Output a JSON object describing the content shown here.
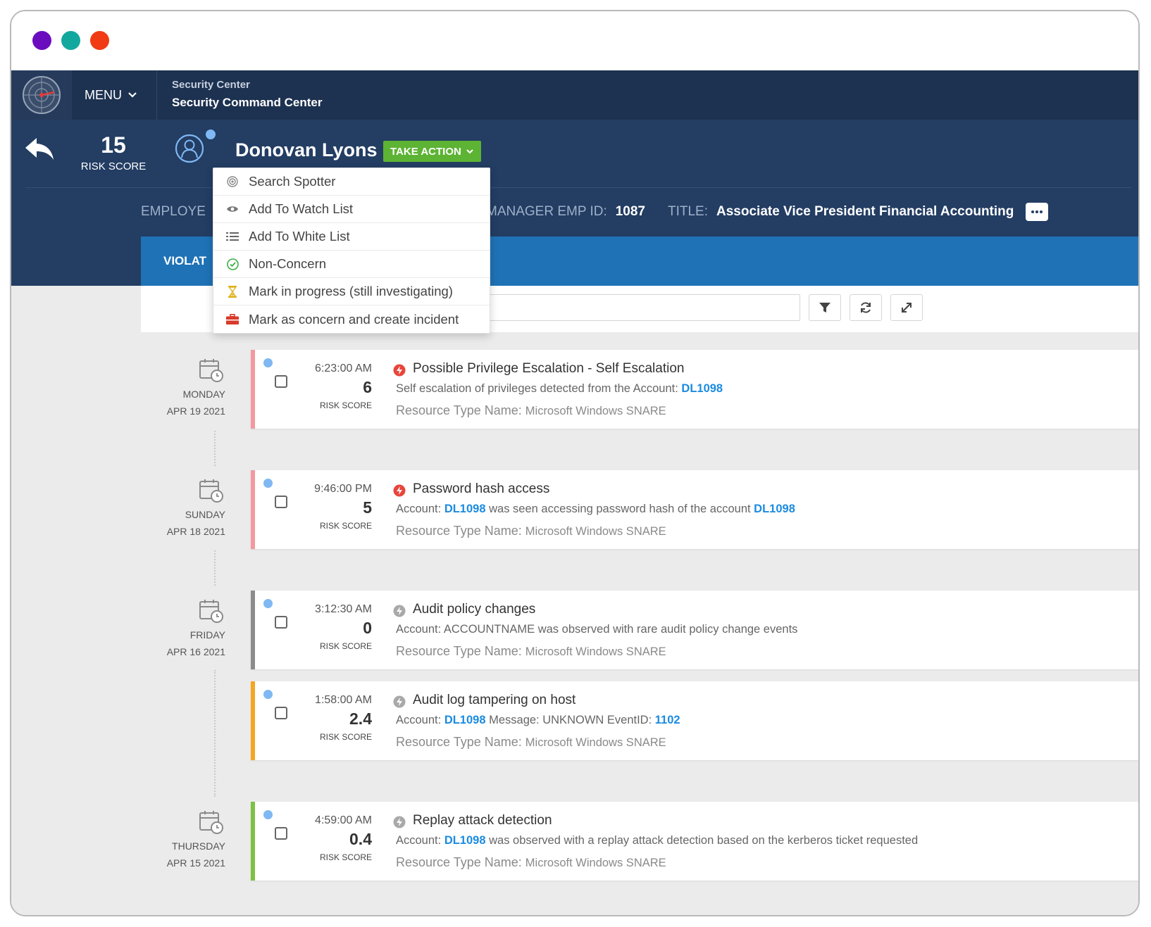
{
  "app": {
    "menu_label": "MENU",
    "breadcrumb": "Security Center",
    "title": "Security Command Center"
  },
  "profile": {
    "risk_score": "15",
    "risk_label": "RISK SCORE",
    "name": "Donovan Lyons",
    "take_action_label": "TAKE ACTION",
    "employee_label": "EMPLOYE",
    "manager_label": "MANAGER EMP ID:",
    "manager_value": "1087",
    "title_label": "TITLE:",
    "title_value": "Associate Vice President Financial Accounting"
  },
  "tabs": {
    "violations_label": "VIOLAT"
  },
  "dropdown": {
    "items": [
      {
        "label": "Search Spotter",
        "icon": "target-icon"
      },
      {
        "label": "Add To Watch List",
        "icon": "eye-icon"
      },
      {
        "label": "Add To White List",
        "icon": "list-icon"
      },
      {
        "label": "Non-Concern",
        "icon": "check-circle-icon"
      },
      {
        "label": "Mark in progress (still investigating)",
        "icon": "hourglass-icon"
      },
      {
        "label": "Mark as concern and create incident",
        "icon": "briefcase-icon"
      }
    ]
  },
  "days": [
    {
      "name": "MONDAY",
      "date": "APR 19 2021"
    },
    {
      "name": "SUNDAY",
      "date": "APR 18 2021"
    },
    {
      "name": "FRIDAY",
      "date": "APR 16 2021"
    },
    {
      "name": "THURSDAY",
      "date": "APR 15 2021"
    }
  ],
  "events": [
    {
      "time": "6:23:00 AM",
      "score": "6",
      "score_label": "RISK SCORE",
      "title": "Possible Privilege Escalation - Self Escalation",
      "desc_a": "Self escalation of privileges detected from the Account:",
      "link1": "DL1098",
      "desc_b": "",
      "link2": "",
      "res_label": "Resource Type Name:",
      "res_value": "Microsoft Windows SNARE",
      "color": "#f29aa0",
      "severity": "high"
    },
    {
      "time": "9:46:00 PM",
      "score": "5",
      "score_label": "RISK SCORE",
      "title": "Password hash access",
      "desc_a": "Account:",
      "link1": "DL1098",
      "desc_b": "was seen accessing password hash of the account",
      "link2": "DL1098",
      "res_label": "Resource Type Name:",
      "res_value": "Microsoft Windows SNARE",
      "color": "#f29aa0",
      "severity": "high"
    },
    {
      "time": "3:12:30 AM",
      "score": "0",
      "score_label": "RISK SCORE",
      "title": "Audit policy changes",
      "desc_a": "Account: ACCOUNTNAME was observed with rare audit policy change events",
      "link1": "",
      "desc_b": "",
      "link2": "",
      "res_label": "Resource Type Name:",
      "res_value": "Microsoft Windows SNARE",
      "color": "#8c8c8c",
      "severity": "low"
    },
    {
      "time": "1:58:00 AM",
      "score": "2.4",
      "score_label": "RISK SCORE",
      "title": "Audit log tampering on host",
      "desc_a": "Account:",
      "link1": "DL1098",
      "desc_b": "Message: UNKNOWN EventID:",
      "link2": "1102",
      "res_label": "Resource Type Name:",
      "res_value": "Microsoft Windows SNARE",
      "color": "#f5a623",
      "severity": "low"
    },
    {
      "time": "4:59:00 AM",
      "score": "0.4",
      "score_label": "RISK SCORE",
      "title": "Replay attack detection",
      "desc_a": "Account:",
      "link1": "DL1098",
      "desc_b": "was observed with a replay attack detection based on the kerberos ticket requested",
      "link2": "",
      "res_label": "Resource Type Name:",
      "res_value": "Microsoft Windows SNARE",
      "color": "#7dc142",
      "severity": "low"
    }
  ]
}
